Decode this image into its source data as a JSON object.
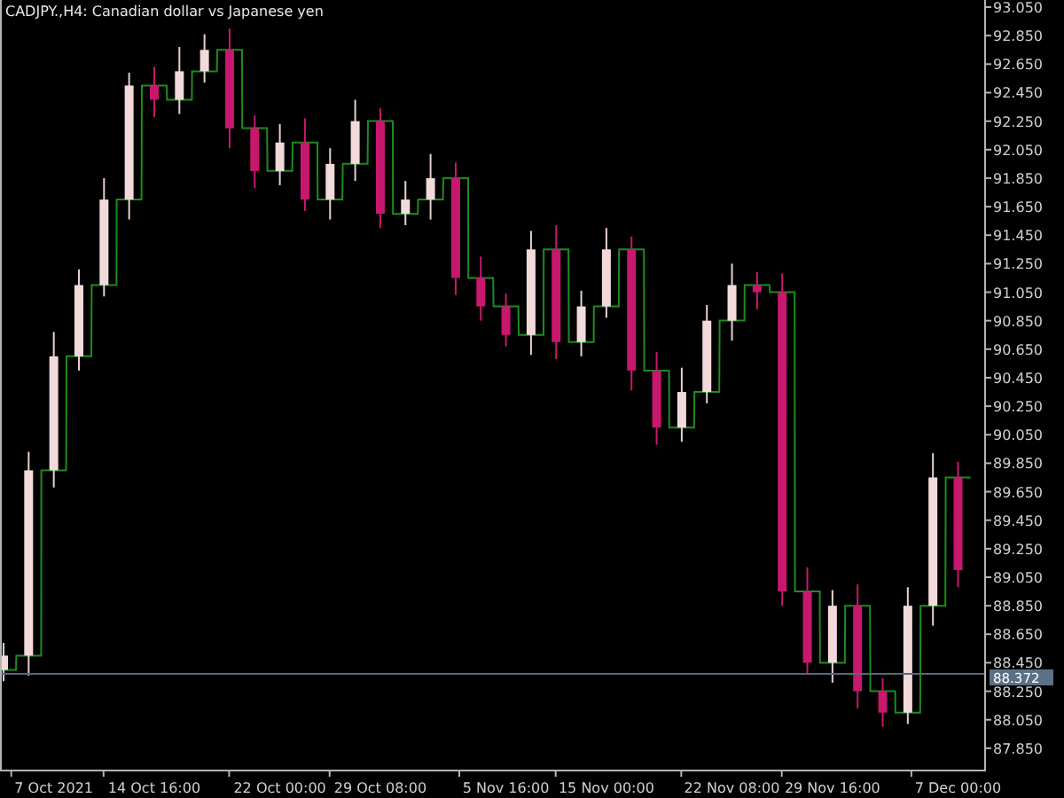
{
  "chart_title": "CADJPY.,H4:  Canadian dollar vs Japanese yen",
  "chart": {
    "chart_data": {
      "type": "candlestick",
      "categories": [
        null,
        null,
        "7 Oct 2021",
        null,
        null,
        null,
        "14 Oct 16:00",
        null,
        null,
        null,
        null,
        "22 Oct 00:00",
        null,
        null,
        null,
        "29 Oct 08:00",
        null,
        null,
        null,
        null,
        "5 Nov 16:00",
        null,
        null,
        null,
        "15 Nov 00:00",
        null,
        null,
        null,
        null,
        "22 Nov 08:00",
        null,
        null,
        null,
        "29 Nov 16:00",
        null,
        null,
        null,
        null,
        "7 Dec 00:00"
      ],
      "ohlc": [
        [
          88.4,
          88.59,
          88.32,
          88.5
        ],
        [
          88.5,
          89.93,
          88.36,
          89.8
        ],
        [
          89.8,
          90.77,
          89.68,
          90.6
        ],
        [
          90.6,
          91.21,
          90.5,
          91.1
        ],
        [
          91.1,
          91.85,
          91.02,
          91.7
        ],
        [
          91.7,
          92.59,
          91.56,
          92.5
        ],
        [
          92.5,
          92.63,
          92.28,
          92.4
        ],
        [
          92.4,
          92.77,
          92.3,
          92.6
        ],
        [
          92.6,
          92.86,
          92.52,
          92.75
        ],
        [
          92.75,
          92.9,
          92.06,
          92.2
        ],
        [
          92.2,
          92.29,
          91.78,
          91.9
        ],
        [
          91.9,
          92.23,
          91.8,
          92.1
        ],
        [
          92.1,
          92.27,
          91.62,
          91.7
        ],
        [
          91.7,
          92.06,
          91.56,
          91.95
        ],
        [
          91.95,
          92.4,
          91.83,
          92.25
        ],
        [
          92.25,
          92.34,
          91.5,
          91.6
        ],
        [
          91.6,
          91.83,
          91.52,
          91.7
        ],
        [
          91.7,
          92.02,
          91.56,
          91.85
        ],
        [
          91.85,
          91.96,
          91.03,
          91.15
        ],
        [
          91.15,
          91.3,
          90.85,
          90.95
        ],
        [
          90.95,
          91.04,
          90.67,
          90.75
        ],
        [
          90.75,
          91.48,
          90.61,
          91.35
        ],
        [
          91.35,
          91.52,
          90.58,
          90.7
        ],
        [
          90.7,
          91.06,
          90.6,
          90.95
        ],
        [
          90.95,
          91.5,
          90.87,
          91.35
        ],
        [
          91.35,
          91.44,
          90.36,
          90.5
        ],
        [
          90.5,
          90.63,
          89.98,
          90.1
        ],
        [
          90.1,
          90.52,
          90.0,
          90.35
        ],
        [
          90.35,
          90.96,
          90.27,
          90.85
        ],
        [
          90.85,
          91.25,
          90.71,
          91.1
        ],
        [
          91.1,
          91.19,
          90.93,
          91.05
        ],
        [
          91.05,
          91.18,
          88.85,
          88.95
        ],
        [
          88.95,
          89.12,
          88.37,
          88.45
        ],
        [
          88.45,
          88.96,
          88.31,
          88.85
        ],
        [
          88.85,
          89.0,
          88.13,
          88.25
        ],
        [
          88.25,
          88.34,
          88.0,
          88.1
        ],
        [
          88.1,
          88.98,
          88.02,
          88.85
        ],
        [
          88.85,
          89.92,
          88.71,
          89.75
        ],
        [
          89.75,
          89.86,
          88.98,
          89.1
        ]
      ],
      "ylim": [
        87.7,
        93.1
      ],
      "yticks": [
        {
          "value": 93.05,
          "label": "93.050"
        },
        {
          "value": 92.85,
          "label": "92.850"
        },
        {
          "value": 92.65,
          "label": "92.650"
        },
        {
          "value": 92.45,
          "label": "92.450"
        },
        {
          "value": 92.25,
          "label": "92.250"
        },
        {
          "value": 92.05,
          "label": "92.050"
        },
        {
          "value": 91.85,
          "label": "91.850"
        },
        {
          "value": 91.65,
          "label": "91.650"
        },
        {
          "value": 91.45,
          "label": "91.450"
        },
        {
          "value": 91.25,
          "label": "91.250"
        },
        {
          "value": 91.05,
          "label": "91.050"
        },
        {
          "value": 90.85,
          "label": "90.850"
        },
        {
          "value": 90.65,
          "label": "90.650"
        },
        {
          "value": 90.45,
          "label": "90.450"
        },
        {
          "value": 90.25,
          "label": "90.250"
        },
        {
          "value": 90.05,
          "label": "90.050"
        },
        {
          "value": 89.85,
          "label": "89.850"
        },
        {
          "value": 89.65,
          "label": "89.650"
        },
        {
          "value": 89.45,
          "label": "89.450"
        },
        {
          "value": 89.25,
          "label": "89.250"
        },
        {
          "value": 89.05,
          "label": "89.050"
        },
        {
          "value": 88.85,
          "label": "88.850"
        },
        {
          "value": 88.65,
          "label": "88.650"
        },
        {
          "value": 88.45,
          "label": "88.450"
        },
        {
          "value": 88.25,
          "label": "88.250"
        },
        {
          "value": 88.05,
          "label": "88.050"
        },
        {
          "value": 87.85,
          "label": "87.850"
        }
      ],
      "ref_lines": [
        {
          "axis": "y",
          "value": 88.372,
          "label": "88.372",
          "color": "#56687c"
        }
      ]
    }
  }
}
